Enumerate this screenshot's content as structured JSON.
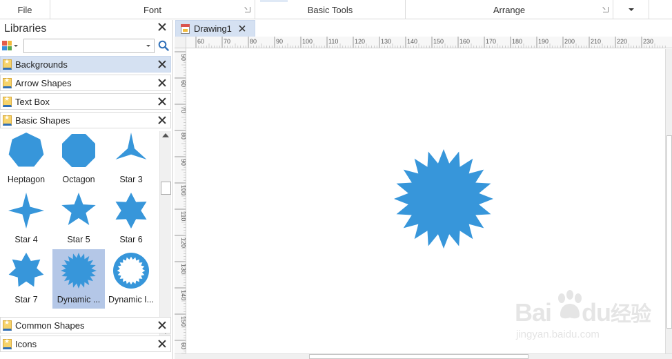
{
  "ribbon": {
    "groups": [
      "File",
      "Font",
      "Basic Tools",
      "Arrange"
    ]
  },
  "libraries": {
    "title": "Libraries",
    "search": {
      "value": "",
      "placeholder": ""
    },
    "categories": [
      {
        "label": "Backgrounds",
        "active": true
      },
      {
        "label": "Arrow Shapes",
        "active": false
      },
      {
        "label": "Text Box",
        "active": false
      },
      {
        "label": "Basic Shapes",
        "active": false
      },
      {
        "label": "Common Shapes",
        "active": false
      },
      {
        "label": "Icons",
        "active": false
      }
    ],
    "shapes": [
      {
        "label": "Heptagon",
        "icon": "heptagon-icon"
      },
      {
        "label": "Octagon",
        "icon": "octagon-icon"
      },
      {
        "label": "Star 3",
        "icon": "star-3-icon"
      },
      {
        "label": "Star 4",
        "icon": "star-4-icon"
      },
      {
        "label": "Star 5",
        "icon": "star-5-icon"
      },
      {
        "label": "Star 6",
        "icon": "star-6-icon"
      },
      {
        "label": "Star 7",
        "icon": "star-7-icon"
      },
      {
        "label": "Dynamic ...",
        "icon": "dynamic-star-icon",
        "selected": true
      },
      {
        "label": "Dynamic I...",
        "icon": "dynamic-inner-star-icon"
      }
    ]
  },
  "document": {
    "tab_label": "Drawing1"
  },
  "rulers": {
    "horizontal": [
      "60",
      "70",
      "80",
      "90",
      "100",
      "110",
      "120",
      "130",
      "140",
      "150",
      "160",
      "170",
      "180",
      "190",
      "200",
      "210",
      "220",
      "230"
    ],
    "vertical": [
      "50",
      "60",
      "70",
      "80",
      "90",
      "100",
      "110",
      "120",
      "130",
      "140",
      "150",
      "60"
    ]
  },
  "canvas": {
    "shape": "dynamic-star",
    "shape_color": "#3796da"
  },
  "watermark": {
    "brand": "Bai",
    "brand_suffix": "du",
    "brand_cn": "经验",
    "url": "jingyan.baidu.com"
  },
  "colors": {
    "accent": "#3796da",
    "selected_bg": "#b4c7e7",
    "active_category_bg": "#d5e1f2"
  }
}
